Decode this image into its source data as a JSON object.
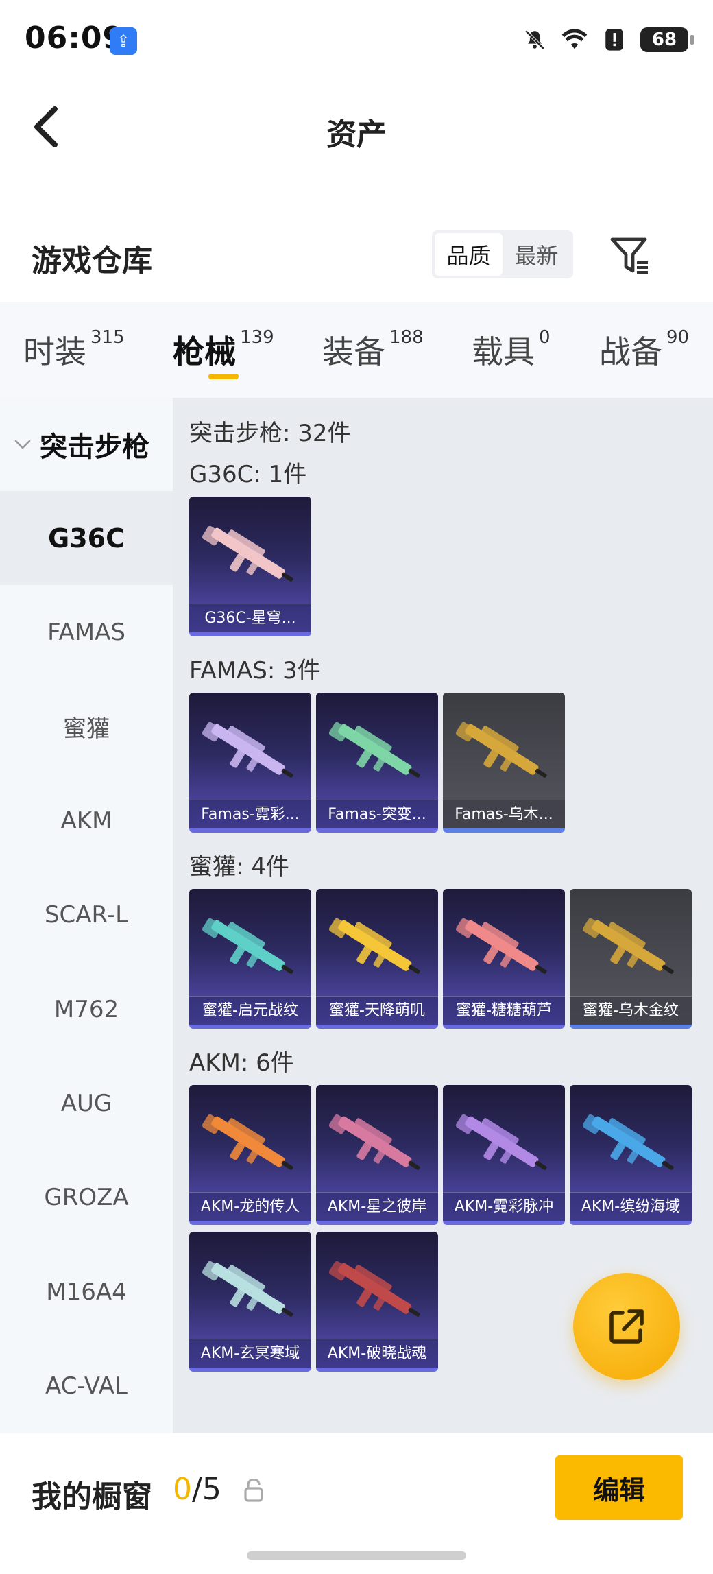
{
  "status": {
    "time": "06:09",
    "battery": "68"
  },
  "header": {
    "title": "资产",
    "back_icon": "back-arrow-icon"
  },
  "warehouse": {
    "title": "游戏仓库",
    "sort_options": [
      "品质",
      "最新"
    ],
    "sort_active": "品质"
  },
  "tabs": [
    {
      "label": "时装",
      "count": "315"
    },
    {
      "label": "枪械",
      "count": "139"
    },
    {
      "label": "装备",
      "count": "188"
    },
    {
      "label": "载具",
      "count": "0"
    },
    {
      "label": "战备",
      "count": "90"
    }
  ],
  "active_tab": "枪械",
  "sidebar": {
    "group": "突击步枪",
    "items": [
      "G36C",
      "FAMAS",
      "蜜獾",
      "AKM",
      "SCAR-L",
      "M762",
      "AUG",
      "GROZA",
      "M16A4",
      "AC-VAL"
    ],
    "active": "G36C"
  },
  "content": {
    "category_total": "突击步枪: 32件",
    "sections": [
      {
        "title": "G36C: 1件",
        "items": [
          {
            "name": "G36C-星穹...",
            "accent": "#f2c6c8"
          }
        ]
      },
      {
        "title": "FAMAS: 3件",
        "items": [
          {
            "name": "Famas-霓彩...",
            "accent": "#c9b6f0"
          },
          {
            "name": "Famas-突变...",
            "accent": "#7ed6a6"
          },
          {
            "name": "Famas-乌木...",
            "accent": "#d6a73a",
            "grey": true
          }
        ]
      },
      {
        "title": "蜜獾: 4件",
        "items": [
          {
            "name": "蜜獾-启元战纹",
            "accent": "#5fd0c8"
          },
          {
            "name": "蜜獾-天降萌叽",
            "accent": "#f4c638"
          },
          {
            "name": "蜜獾-糖糖葫芦",
            "accent": "#f08a8a"
          },
          {
            "name": "蜜獾-乌木金纹",
            "accent": "#d6a73a",
            "grey": true
          }
        ]
      },
      {
        "title": "AKM: 6件",
        "items": [
          {
            "name": "AKM-龙的传人",
            "accent": "#f08a3a"
          },
          {
            "name": "AKM-星之彼岸",
            "accent": "#d87aa0"
          },
          {
            "name": "AKM-霓彩脉冲",
            "accent": "#b28ae6"
          },
          {
            "name": "AKM-缤纷海域",
            "accent": "#4aa8e8"
          },
          {
            "name": "AKM-玄冥寒域",
            "accent": "#b8e0e0"
          },
          {
            "name": "AKM-破晓战魂",
            "accent": "#c04a4a"
          }
        ]
      }
    ]
  },
  "showcase": {
    "title": "我的橱窗",
    "current": "0",
    "total": "/5",
    "edit_label": "编辑"
  },
  "colors": {
    "accent": "#f5b600",
    "card_top": "#1e1a3a",
    "card_bottom": "#5a4fb8"
  }
}
